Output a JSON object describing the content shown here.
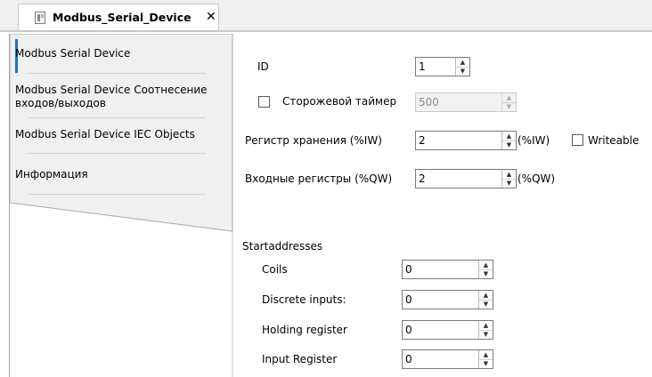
{
  "tab": {
    "title": "Modbus_Serial_Device",
    "close_glyph": "✕"
  },
  "sidebar": {
    "items": [
      {
        "label": "Modbus Serial Device"
      },
      {
        "label": "Modbus Serial Device Соотнесение входов/выходов"
      },
      {
        "label": "Modbus Serial Device IEC Objects"
      },
      {
        "label": "Информация"
      }
    ]
  },
  "settings": {
    "id_label": "ID",
    "id_value": "1",
    "watchdog_label": "Сторожевой таймер",
    "watchdog_checked": false,
    "watchdog_value": "500",
    "holding_label": "Регистр хранения (%IW)",
    "holding_value": "2",
    "holding_suffix": "(%IW)",
    "writeable_label": "Writeable",
    "writeable_checked": false,
    "input_label": "Входные регистры (%QW)",
    "input_value": "2",
    "input_suffix": "(%QW)"
  },
  "start_addresses": {
    "heading": "Startaddresses",
    "rows": [
      {
        "label": "Coils",
        "value": "0"
      },
      {
        "label": "Discrete inputs:",
        "value": "0"
      },
      {
        "label": "Holding register",
        "value": "0"
      },
      {
        "label": "Input Register",
        "value": "0"
      }
    ]
  },
  "colors": {
    "accent": "#1c6fd1",
    "sidebar_bg": "#f0f0f0",
    "border": "#a9a9a9"
  },
  "icons": {
    "tab": "device-icon",
    "spin_up": "▲",
    "spin_down": "▼"
  }
}
